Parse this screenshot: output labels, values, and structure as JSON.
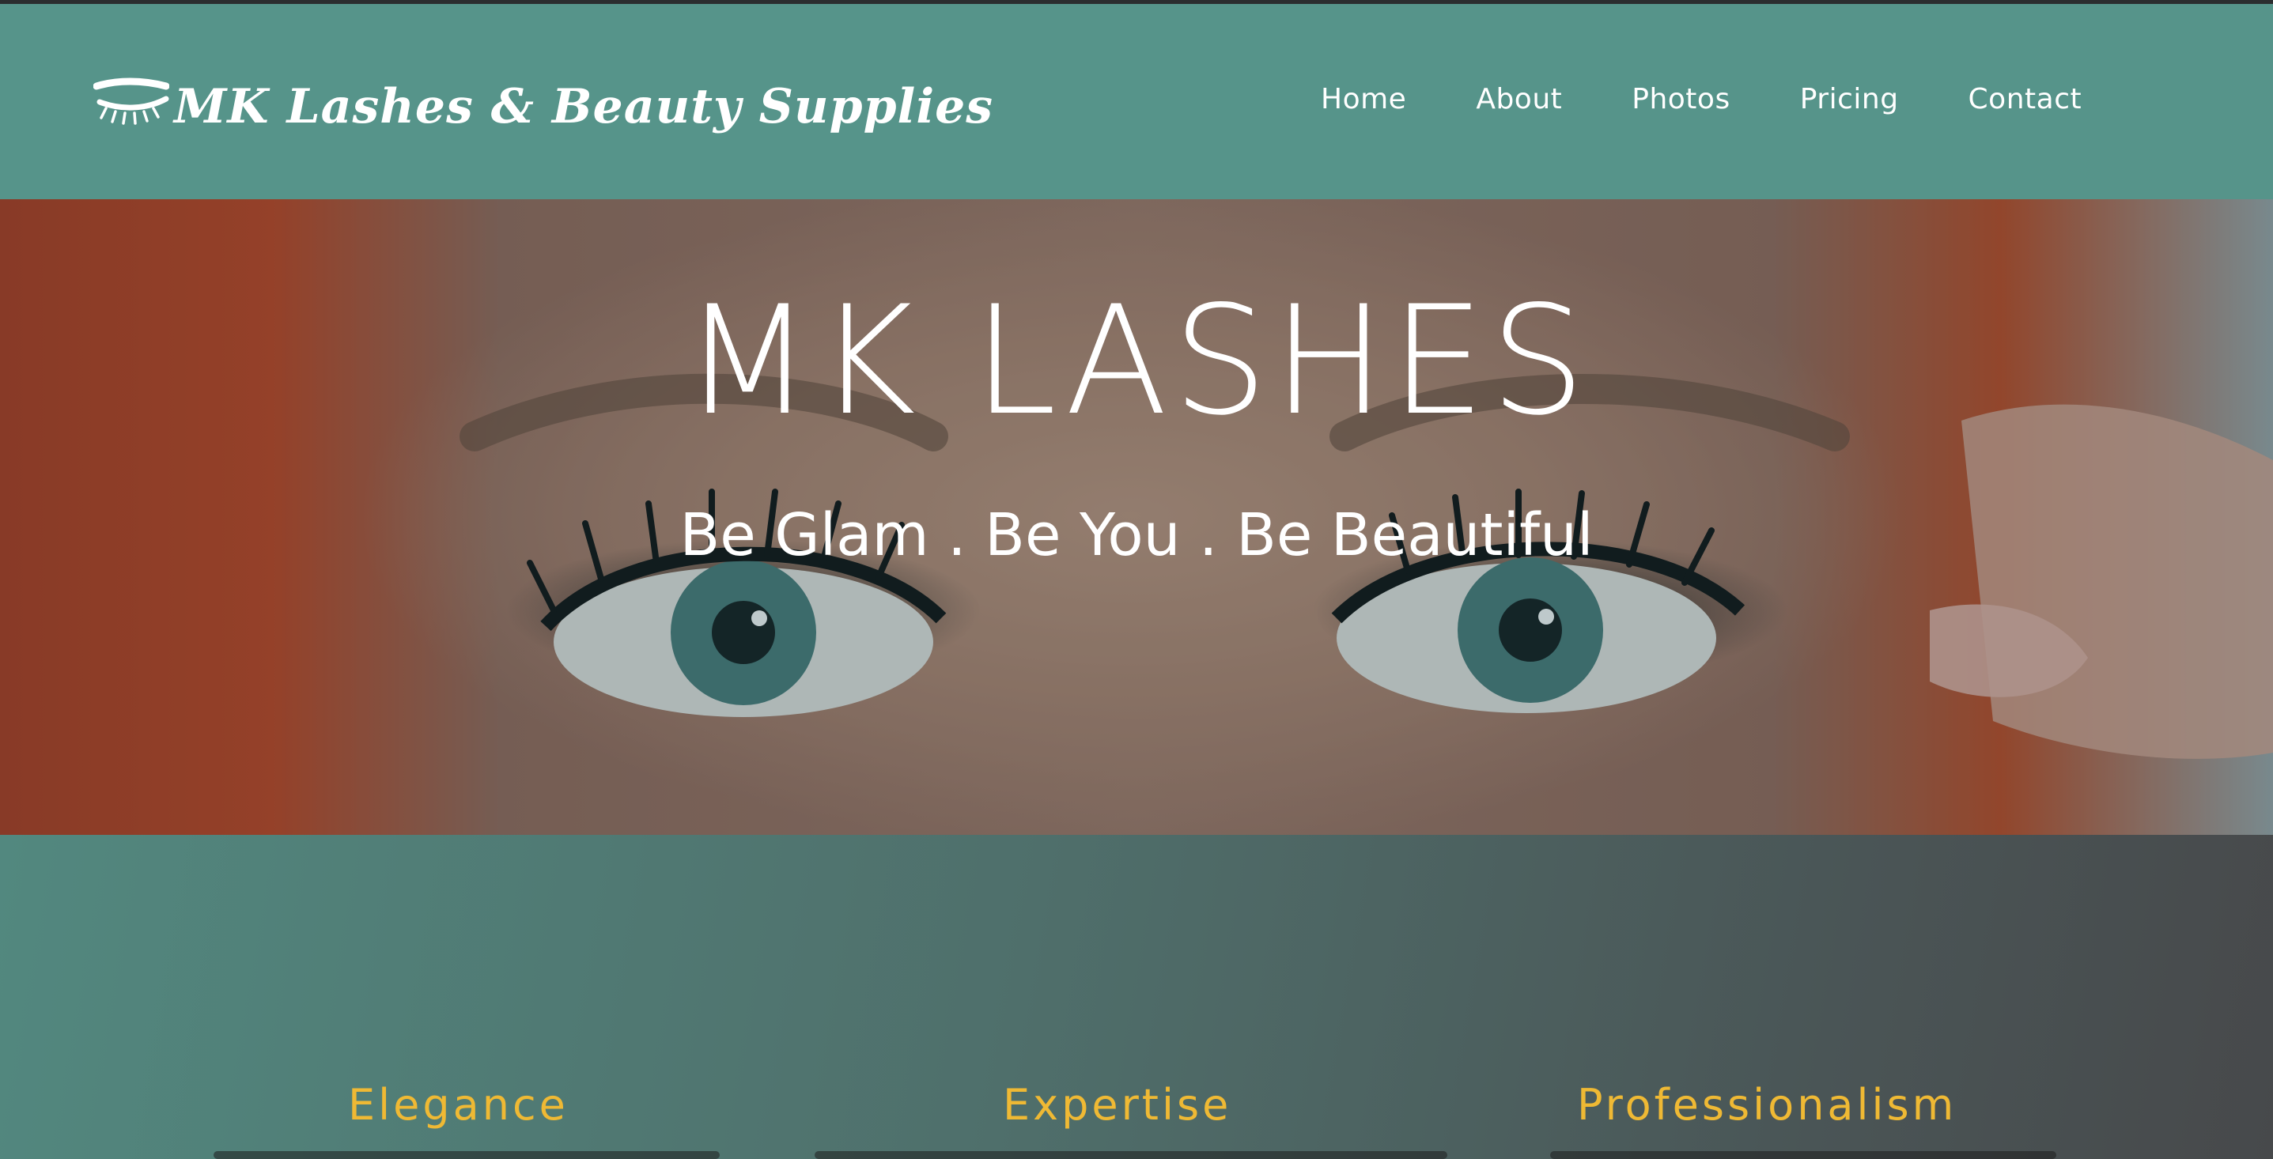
{
  "brand": {
    "name": "MK Lashes & Beauty Supplies",
    "logo_icon": "eyelash-icon"
  },
  "nav": {
    "items": [
      {
        "label": "Home"
      },
      {
        "label": "About"
      },
      {
        "label": "Photos"
      },
      {
        "label": "Pricing"
      },
      {
        "label": "Contact"
      }
    ]
  },
  "hero": {
    "title": "MK LASHES",
    "tagline": "Be Glam . Be You . Be Beautiful"
  },
  "values": [
    {
      "label": "Elegance"
    },
    {
      "label": "Expertise"
    },
    {
      "label": "Professionalism"
    }
  ],
  "colors": {
    "header_bg": "#56948a",
    "accent_gold": "#efb934",
    "text_white": "#ffffff"
  }
}
